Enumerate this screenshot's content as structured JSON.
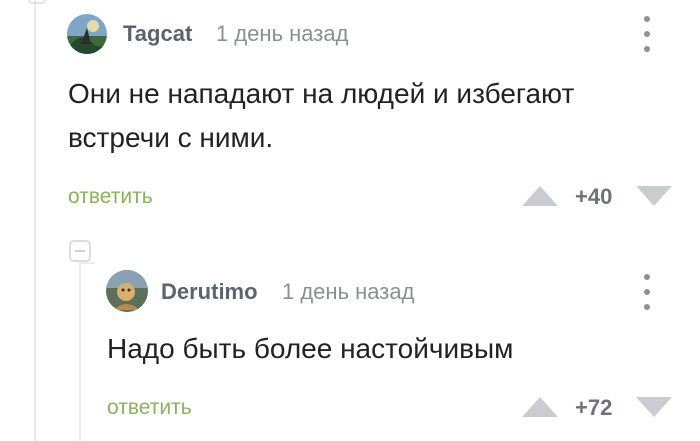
{
  "comments": [
    {
      "author": "Tagcat",
      "time": "1 день назад",
      "text_lines": [
        "Они не нападают на людей и избегают",
        "встречи с ними."
      ],
      "reply_label": "ответить",
      "score": "+40"
    },
    {
      "author": "Derutimo",
      "time": "1 день назад",
      "text_lines": [
        "Надо быть более настойчивым"
      ],
      "reply_label": "ответить",
      "score": "+72"
    }
  ],
  "colors": {
    "reply": "#8ab35a",
    "author": "#5a6470",
    "meta": "#8b8f94",
    "vote_arrow": "#c9cdd1"
  },
  "icons": [
    "avatar",
    "kebab-menu-icon",
    "vote-up-icon",
    "vote-down-icon",
    "collapse-thread-icon"
  ]
}
